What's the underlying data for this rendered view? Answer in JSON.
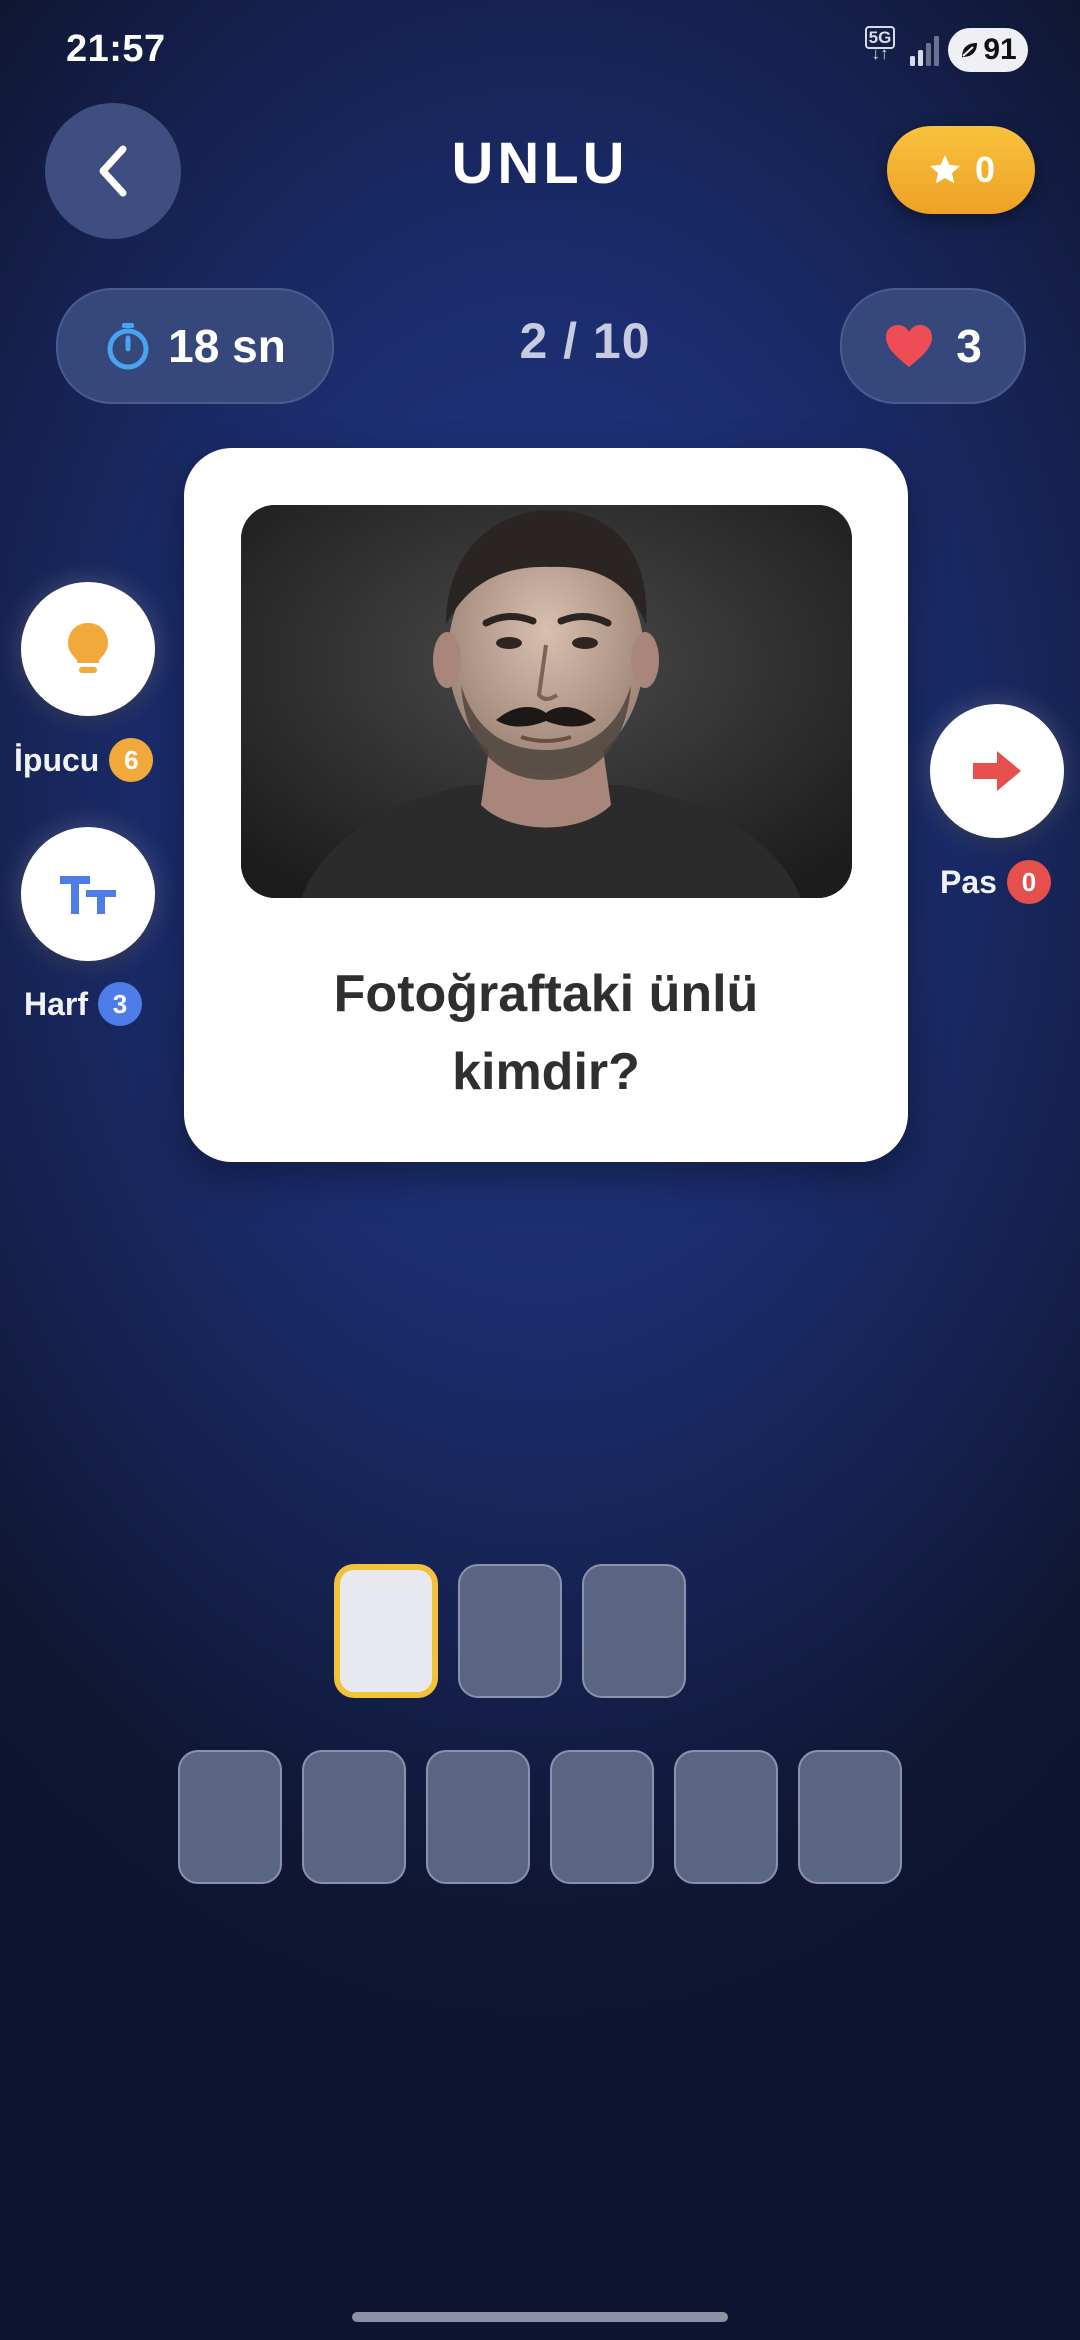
{
  "status_bar": {
    "time": "21:57",
    "network": "5G",
    "battery": "91"
  },
  "header": {
    "title": "UNLU",
    "score": "0"
  },
  "stats": {
    "timer": "18 sn",
    "progress": "2 / 10",
    "lives": "3"
  },
  "card": {
    "photo_alt": "celebrity-photo",
    "question": "Fotoğraftaki ünlü kimdir?"
  },
  "side_actions": {
    "hint": {
      "label": "İpucu",
      "count": "6",
      "color": "#f2a93b",
      "icon": "lightbulb-icon"
    },
    "letter": {
      "label": "Harf",
      "count": "3",
      "color": "#4f7de8",
      "icon": "text-size-icon"
    },
    "pass": {
      "label": "Pas",
      "count": "0",
      "color": "#e5504c",
      "icon": "arrow-right-icon"
    }
  },
  "answer": {
    "rows": [
      3,
      6
    ]
  },
  "colors": {
    "accent": "#f2c23a",
    "heart": "#ee4d55",
    "timer_icon": "#4aa3f0"
  }
}
